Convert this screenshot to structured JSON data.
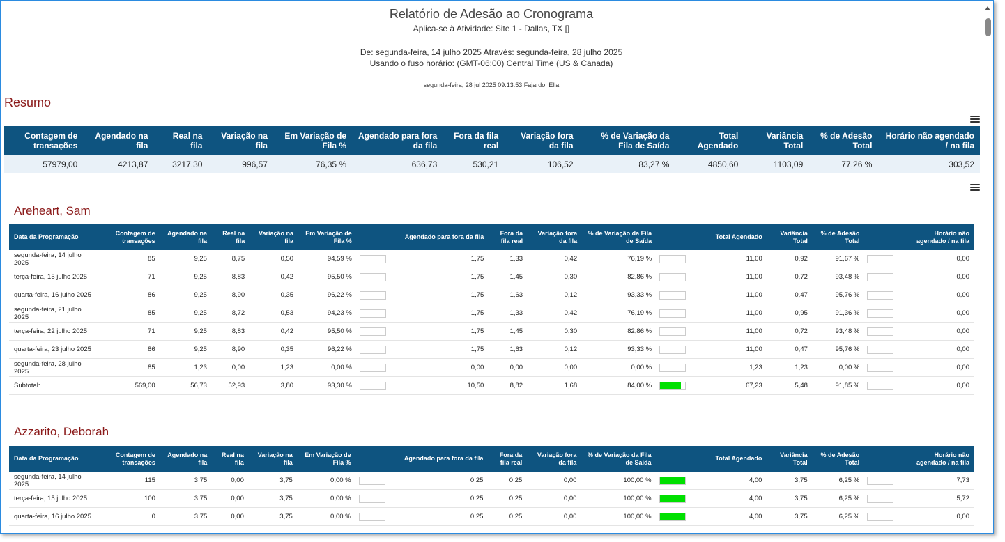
{
  "report": {
    "title": "Relatório de Adesão ao Cronograma",
    "subtitle": "Aplica-se à Atividade: Site 1 - Dallas, TX []",
    "range": "De: segunda-feira, 14 julho 2025 Através: segunda-feira, 28 julho 2025",
    "timezone": "Usando o fuso horário: (GMT-06:00) Central Time (US & Canada)",
    "stamp": "segunda-feira, 28 jul 2025 09:13:53  Fajardo, Ella"
  },
  "summary": {
    "title": "Resumo",
    "headers": [
      "Contagem de transações",
      "Agendado na fila",
      "Real na fila",
      "Variação na fila",
      "Em Variação de Fila %",
      "Agendado para fora da fila",
      "Fora da fila real",
      "Variação fora da fila",
      "% de Variação da Fila de Saída",
      "Total Agendado",
      "Variância Total",
      "% de Adesão Total",
      "Horário não agendado / na fila"
    ],
    "values": [
      "57979,00",
      "4213,87",
      "3217,30",
      "996,57",
      "76,35 %",
      "636,73",
      "530,21",
      "106,52",
      "83,27 %",
      "4850,60",
      "1103,09",
      "77,26 %",
      "303,52"
    ]
  },
  "table_headers": [
    "Data da Programação",
    "Contagem de transações",
    "Agendado na fila",
    "Real na fila",
    "Variação na fila",
    "Em Variação de Fila %",
    "Agendado para fora da fila",
    "Fora da fila real",
    "Variação fora da fila",
    "% de Variação da Fila de Saída",
    "Total Agendado",
    "Variância Total",
    "% de Adesão Total",
    "Horário não agendado / na fila"
  ],
  "people": [
    {
      "name": "Areheart, Sam",
      "rows": [
        {
          "date": "segunda-feira, 14 julho 2025",
          "c": "85",
          "sq": "9,25",
          "rq": "8,75",
          "vq": "0,50",
          "pq": "94,59 %",
          "bq": 0,
          "so": "1,75",
          "ro": "1,33",
          "vo": "0,42",
          "po": "76,19 %",
          "bo": 0,
          "ts": "11,00",
          "tv": "0,92",
          "pa": "91,67 %",
          "ba": 0,
          "un": "0,00"
        },
        {
          "date": "terça-feira, 15 julho 2025",
          "c": "71",
          "sq": "9,25",
          "rq": "8,83",
          "vq": "0,42",
          "pq": "95,50 %",
          "bq": 0,
          "so": "1,75",
          "ro": "1,45",
          "vo": "0,30",
          "po": "82,86 %",
          "bo": 0,
          "ts": "11,00",
          "tv": "0,72",
          "pa": "93,48 %",
          "ba": 0,
          "un": "0,00"
        },
        {
          "date": "quarta-feira, 16 julho 2025",
          "c": "86",
          "sq": "9,25",
          "rq": "8,90",
          "vq": "0,35",
          "pq": "96,22 %",
          "bq": 0,
          "so": "1,75",
          "ro": "1,63",
          "vo": "0,12",
          "po": "93,33 %",
          "bo": 0,
          "ts": "11,00",
          "tv": "0,47",
          "pa": "95,76 %",
          "ba": 0,
          "un": "0,00"
        },
        {
          "date": "segunda-feira, 21 julho 2025",
          "c": "85",
          "sq": "9,25",
          "rq": "8,72",
          "vq": "0,53",
          "pq": "94,23 %",
          "bq": 0,
          "so": "1,75",
          "ro": "1,33",
          "vo": "0,42",
          "po": "76,19 %",
          "bo": 0,
          "ts": "11,00",
          "tv": "0,95",
          "pa": "91,36 %",
          "ba": 0,
          "un": "0,00"
        },
        {
          "date": "terça-feira, 22 julho 2025",
          "c": "71",
          "sq": "9,25",
          "rq": "8,83",
          "vq": "0,42",
          "pq": "95,50 %",
          "bq": 0,
          "so": "1,75",
          "ro": "1,45",
          "vo": "0,30",
          "po": "82,86 %",
          "bo": 0,
          "ts": "11,00",
          "tv": "0,72",
          "pa": "93,48 %",
          "ba": 0,
          "un": "0,00"
        },
        {
          "date": "quarta-feira, 23 julho 2025",
          "c": "86",
          "sq": "9,25",
          "rq": "8,90",
          "vq": "0,35",
          "pq": "96,22 %",
          "bq": 0,
          "so": "1,75",
          "ro": "1,63",
          "vo": "0,12",
          "po": "93,33 %",
          "bo": 0,
          "ts": "11,00",
          "tv": "0,47",
          "pa": "95,76 %",
          "ba": 0,
          "un": "0,00"
        },
        {
          "date": "segunda-feira, 28 julho 2025",
          "c": "85",
          "sq": "1,23",
          "rq": "0,00",
          "vq": "1,23",
          "pq": "0,00 %",
          "bq": 0,
          "so": "0,00",
          "ro": "0,00",
          "vo": "0,00",
          "po": "0,00 %",
          "bo": 0,
          "ts": "1,23",
          "tv": "1,23",
          "pa": "0,00 %",
          "ba": 0,
          "un": "0,00"
        },
        {
          "date": "Subtotal:",
          "c": "569,00",
          "sq": "56,73",
          "rq": "52,93",
          "vq": "3,80",
          "pq": "93,30 %",
          "bq": 0,
          "so": "10,50",
          "ro": "8,82",
          "vo": "1,68",
          "po": "84,00 %",
          "bo": 0.84,
          "ts": "67,23",
          "tv": "5,48",
          "pa": "91,85 %",
          "ba": 0,
          "un": "0,00"
        }
      ]
    },
    {
      "name": "Azzarito, Deborah",
      "rows": [
        {
          "date": "segunda-feira, 14 julho 2025",
          "c": "115",
          "sq": "3,75",
          "rq": "0,00",
          "vq": "3,75",
          "pq": "0,00 %",
          "bq": 0,
          "so": "0,25",
          "ro": "0,25",
          "vo": "0,00",
          "po": "100,00 %",
          "bo": 1,
          "ts": "4,00",
          "tv": "3,75",
          "pa": "6,25 %",
          "ba": 0,
          "un": "7,73"
        },
        {
          "date": "terça-feira, 15 julho 2025",
          "c": "100",
          "sq": "3,75",
          "rq": "0,00",
          "vq": "3,75",
          "pq": "0,00 %",
          "bq": 0,
          "so": "0,25",
          "ro": "0,25",
          "vo": "0,00",
          "po": "100,00 %",
          "bo": 1,
          "ts": "4,00",
          "tv": "3,75",
          "pa": "6,25 %",
          "ba": 0,
          "un": "5,72"
        },
        {
          "date": "quarta-feira, 16 julho 2025",
          "c": "0",
          "sq": "3,75",
          "rq": "0,00",
          "vq": "3,75",
          "pq": "0,00 %",
          "bq": 0,
          "so": "0,25",
          "ro": "0,25",
          "vo": "0,00",
          "po": "100,00 %",
          "bo": 1,
          "ts": "4,00",
          "tv": "3,75",
          "pa": "6,25 %",
          "ba": 0,
          "un": "0,00"
        }
      ]
    }
  ],
  "colors": {
    "header_bg": "#0e5480",
    "name_color": "#8b1a1a",
    "bar_fill": "#00e000"
  }
}
